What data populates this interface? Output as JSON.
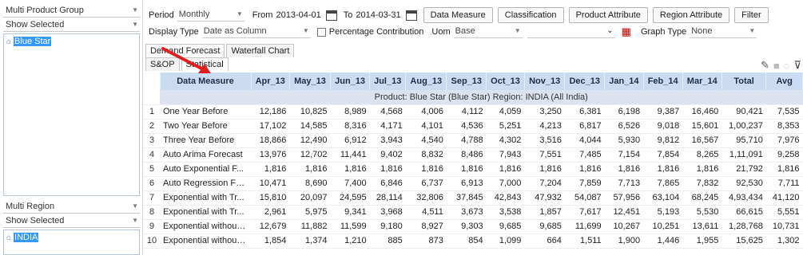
{
  "left_panel": {
    "product_group": {
      "label": "Multi Product Group"
    },
    "product_filter": {
      "label": "Show Selected"
    },
    "product_items": [
      "Blue Star"
    ],
    "region_group": {
      "label": "Multi Region"
    },
    "region_filter": {
      "label": "Show Selected"
    },
    "region_items": [
      "INDIA"
    ]
  },
  "toolbar": {
    "period_label": "Period",
    "period_value": "Monthly",
    "from_label": "From",
    "from_value": "2013-04-01",
    "to_label": "To",
    "to_value": "2014-03-31",
    "buttons": [
      "Data Measure",
      "Classification",
      "Product Attribute",
      "Region Attribute",
      "Filter"
    ],
    "display_type_label": "Display Type",
    "display_type_value": "Date as Column",
    "percentage_label": "Percentage Contribution",
    "uom_label": "Uom",
    "uom_value": "Base",
    "extra_select_value": "",
    "graph_type_label": "Graph Type",
    "graph_type_value": "None"
  },
  "tabs": [
    "Demand Forecast",
    "Waterfall Chart"
  ],
  "subtabs": [
    "S&OP",
    "Statistical"
  ],
  "grid": {
    "columns": [
      "Data Measure",
      "Apr_13",
      "May_13",
      "Jun_13",
      "Jul_13",
      "Aug_13",
      "Sep_13",
      "Oct_13",
      "Nov_13",
      "Dec_13",
      "Jan_14",
      "Feb_14",
      "Mar_14",
      "Total",
      "Avg"
    ],
    "group_label": "Product: Blue Star (Blue Star) Region: INDIA (All India)",
    "rows": [
      {
        "idx": "1",
        "name": "One Year Before",
        "values": [
          "12,186",
          "10,825",
          "8,989",
          "4,568",
          "4,006",
          "4,112",
          "4,059",
          "3,250",
          "6,381",
          "6,198",
          "9,387",
          "16,460",
          "90,421",
          "7,535"
        ]
      },
      {
        "idx": "2",
        "name": "Two Year Before",
        "values": [
          "17,102",
          "14,585",
          "8,316",
          "4,171",
          "4,101",
          "4,536",
          "5,251",
          "4,213",
          "6,817",
          "6,526",
          "9,018",
          "15,601",
          "1,00,237",
          "8,353"
        ]
      },
      {
        "idx": "3",
        "name": "Three Year Before",
        "values": [
          "18,866",
          "12,490",
          "6,912",
          "3,943",
          "4,540",
          "4,788",
          "4,302",
          "3,516",
          "4,044",
          "5,930",
          "9,812",
          "16,567",
          "95,710",
          "7,976"
        ]
      },
      {
        "idx": "4",
        "name": "Auto Arima Forecast",
        "values": [
          "13,976",
          "12,702",
          "11,441",
          "9,402",
          "8,832",
          "8,486",
          "7,943",
          "7,551",
          "7,485",
          "7,154",
          "7,854",
          "8,265",
          "1,11,091",
          "9,258"
        ]
      },
      {
        "idx": "5",
        "name": "Auto Exponential F...",
        "values": [
          "1,816",
          "1,816",
          "1,816",
          "1,816",
          "1,816",
          "1,816",
          "1,816",
          "1,816",
          "1,816",
          "1,816",
          "1,816",
          "1,816",
          "21,792",
          "1,816"
        ]
      },
      {
        "idx": "6",
        "name": "Auto Regression Fo...",
        "values": [
          "10,471",
          "8,690",
          "7,400",
          "6,846",
          "6,737",
          "6,913",
          "7,000",
          "7,204",
          "7,859",
          "7,713",
          "7,865",
          "7,832",
          "92,530",
          "7,711"
        ]
      },
      {
        "idx": "7",
        "name": "Exponential with Tr...",
        "values": [
          "15,810",
          "20,097",
          "24,595",
          "28,114",
          "32,806",
          "37,845",
          "42,843",
          "47,932",
          "54,087",
          "57,956",
          "63,104",
          "68,245",
          "4,93,434",
          "41,120"
        ]
      },
      {
        "idx": "8",
        "name": "Exponential with Tr...",
        "values": [
          "2,961",
          "5,975",
          "9,341",
          "3,968",
          "4,511",
          "3,673",
          "3,538",
          "1,857",
          "7,617",
          "12,451",
          "5,193",
          "5,530",
          "66,615",
          "5,551"
        ]
      },
      {
        "idx": "9",
        "name": "Exponential without ...",
        "values": [
          "12,679",
          "11,882",
          "11,599",
          "9,180",
          "8,927",
          "9,303",
          "9,685",
          "9,685",
          "11,699",
          "10,267",
          "10,251",
          "13,611",
          "1,28,768",
          "10,731"
        ]
      },
      {
        "idx": "10",
        "name": "Exponential without ...",
        "values": [
          "1,854",
          "1,374",
          "1,210",
          "885",
          "873",
          "854",
          "1,099",
          "664",
          "1,511",
          "1,900",
          "1,446",
          "1,955",
          "15,625",
          "1,302"
        ]
      }
    ]
  },
  "colors": {
    "header_bg": "#c9dcf2",
    "group_bg": "#dde3ee",
    "selection": "#3399ff",
    "annotation_arrow": "#e02020"
  },
  "icons": [
    "calendar-icon",
    "export-icon",
    "save-icon",
    "refresh-icon",
    "filter-icon",
    "tree-node-icon"
  ]
}
